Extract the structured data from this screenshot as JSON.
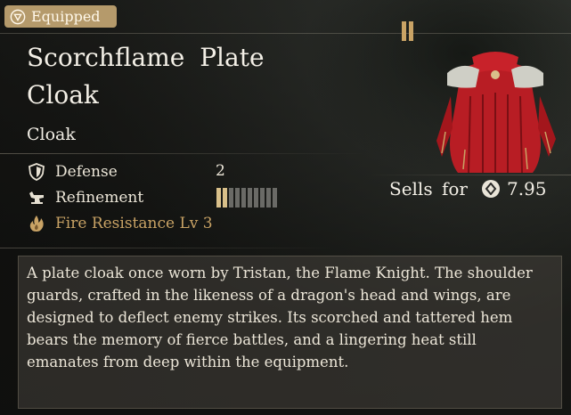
{
  "badge": {
    "label": "Equipped",
    "icon": "equipped-shield-icon"
  },
  "item": {
    "title": "Scorchflame Plate Cloak",
    "type": "Cloak"
  },
  "stats": {
    "defense": {
      "label": "Defense",
      "value": "2",
      "icon": "shield-icon"
    },
    "refinement": {
      "label": "Refinement",
      "icon": "anvil-icon",
      "level": 2,
      "max": 10
    },
    "fire": {
      "label": "Fire Resistance Lv 3",
      "icon": "flame-icon"
    }
  },
  "price": {
    "label": "Sells for",
    "value": "7.95",
    "icon": "coin-icon"
  },
  "description": "A plate cloak once worn by Tristan, the Flame Knight. The shoulder guards, crafted in the likeness of a dragon's head and wings, are designed to deflect enemy strikes. Its scorched and tattered hem bears the memory of fierce battles, and a lingering heat still emanates from deep within the equipment.",
  "colors": {
    "accent": "#c9a365",
    "badge": "#b59a6b",
    "cloak_red": "#c8222a"
  }
}
